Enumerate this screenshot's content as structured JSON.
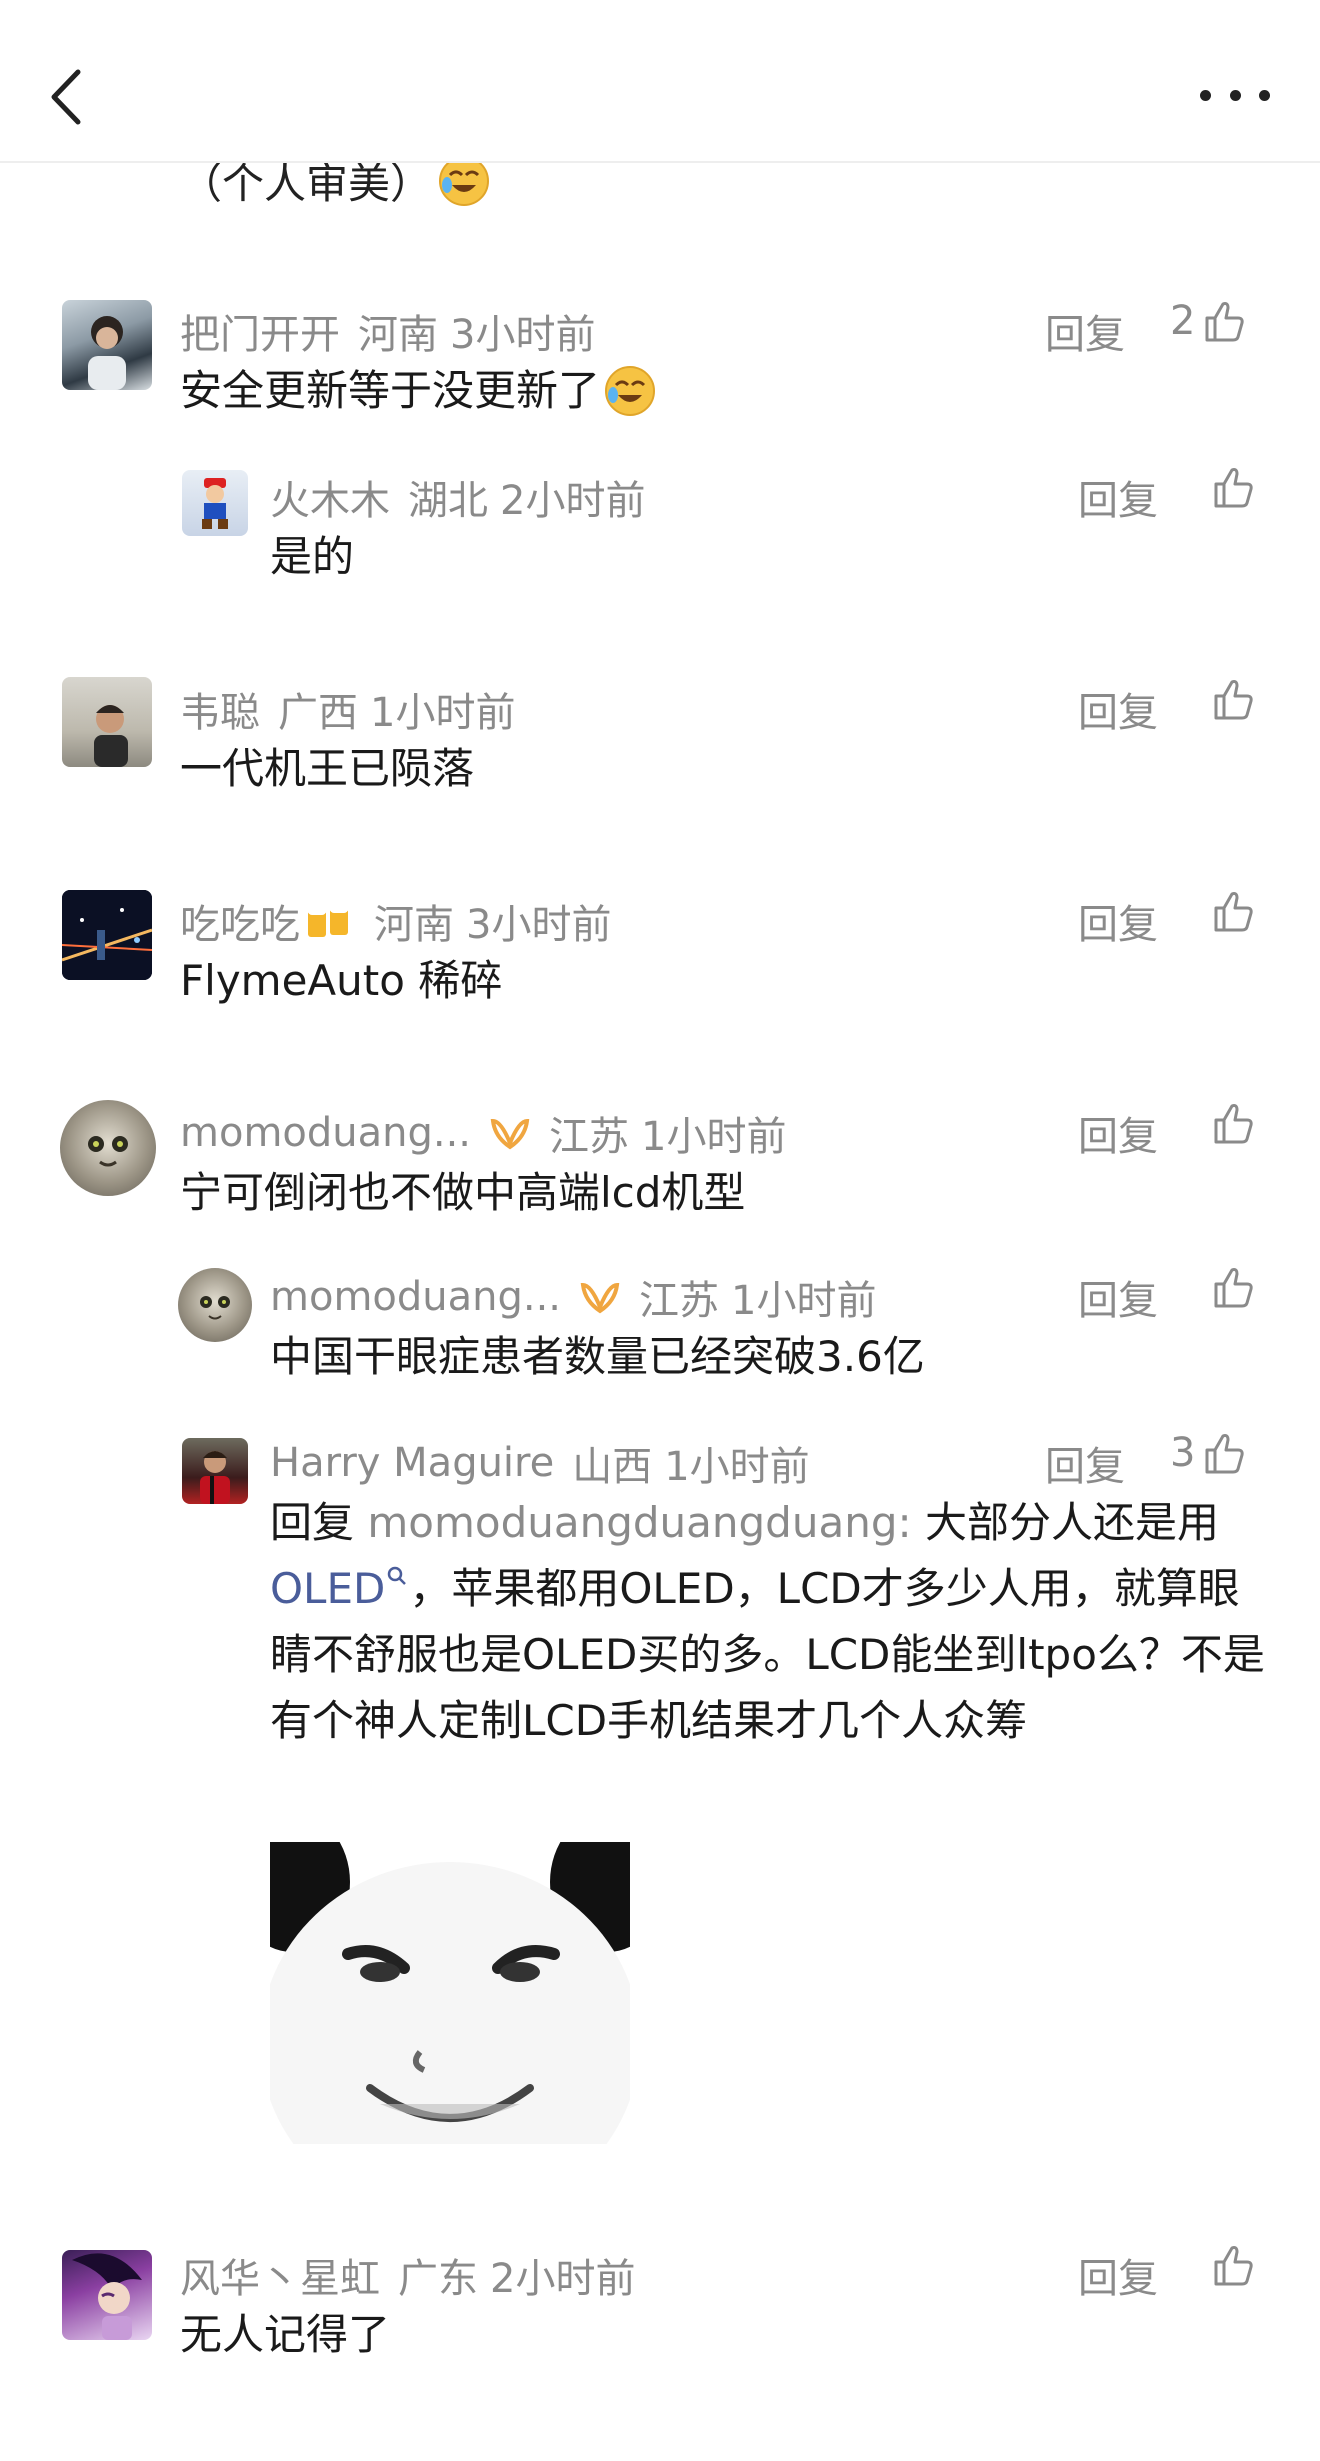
{
  "header": {
    "back_icon": "chevron-left-icon",
    "more_icon": "more-horizontal-icon"
  },
  "partial": {
    "text": "（个人审美）"
  },
  "comments": [
    {
      "user": "把门开开",
      "location": "河南",
      "time": "3小时前",
      "text": "安全更新等于没更新了",
      "reply": "回复",
      "likes": "2"
    },
    {
      "user": "火木木",
      "location": "湖北",
      "time": "2小时前",
      "text": "是的",
      "reply": "回复",
      "likes": ""
    },
    {
      "user": "韦聪",
      "location": "广西",
      "time": "1小时前",
      "text": "一代机王已陨落",
      "reply": "回复",
      "likes": ""
    },
    {
      "user": "吃吃吃",
      "location": "河南",
      "time": "3小时前",
      "text": "FlymeAuto 稀碎",
      "reply": "回复",
      "likes": ""
    },
    {
      "user": "momoduang...",
      "location": "江苏",
      "time": "1小时前",
      "text": "宁可倒闭也不做中高端lcd机型",
      "reply": "回复",
      "likes": ""
    },
    {
      "user": "momoduang...",
      "location": "江苏",
      "time": "1小时前",
      "text": "中国干眼症患者数量已经突破3.6亿",
      "reply": "回复",
      "likes": ""
    },
    {
      "user": "Harry Maguire",
      "location": "山西",
      "time": "1小时前",
      "reply": "回复",
      "likes": "3",
      "reply_prefix": "回复",
      "mention": "momoduangduangduang",
      "colon": ":",
      "text_a": " 大部分人还是用",
      "link": "OLED",
      "text_b": "，苹果都用OLED，LCD才多少人用，就算眼睛不舒服也是OLED买的多。LCD能坐到ltpo么？不是有个神人定制LCD手机结果才几个人众筹"
    },
    {
      "user": "风华丶星虹",
      "location": "广东",
      "time": "2小时前",
      "text": "无人记得了",
      "reply": "回复",
      "likes": ""
    }
  ]
}
